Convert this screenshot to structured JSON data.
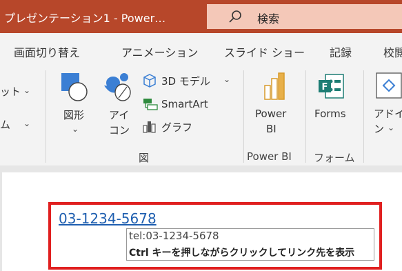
{
  "titlebar": {
    "title": "プレゼンテーション1  -  Power…",
    "search_label": "検索"
  },
  "tabs": [
    "画面切り替え",
    "アニメーション",
    "スライド ショー",
    "記録",
    "校閲"
  ],
  "ribbon": {
    "left_item1": "ット",
    "left_item2": "ム",
    "shapes_label": "図形",
    "icons_label_line1": "アイ",
    "icons_label_line2": "コン",
    "model3d_label": "3D モデル",
    "smartart_label": "SmartArt",
    "graph_label": "グラフ",
    "group_illustrations": "図",
    "powerbi_line1": "Power",
    "powerbi_line2": "BI",
    "group_powerbi": "Power BI",
    "forms_label": "Forms",
    "group_forms": "フォーム",
    "addins_line1": "アドイ",
    "addins_line2": "ン"
  },
  "slide": {
    "link_text": "03-1234-5678",
    "tooltip_url": "tel:03-1234-5678",
    "tooltip_hint": "Ctrl キーを押しながらクリックしてリンク先を表示"
  },
  "colors": {
    "titlebar": "#b7472a",
    "search_box": "#f4c8b8",
    "highlight": "#e02020",
    "link": "#1f5fb0"
  }
}
